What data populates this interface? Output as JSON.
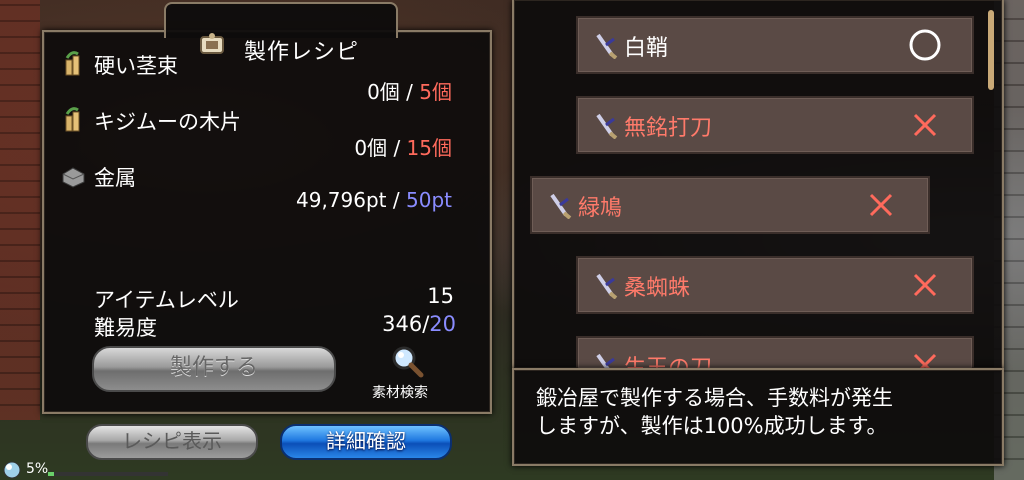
{
  "title": "製作レシピ",
  "materials": [
    {
      "name": "硬い茎束",
      "have": "0個",
      "sep": "/",
      "need": "5個",
      "need_color": "red",
      "icon": "bamboo-icon"
    },
    {
      "name": "キジムーの木片",
      "have": "0個",
      "sep": "/",
      "need": "15個",
      "need_color": "red",
      "icon": "bamboo-icon"
    },
    {
      "name": "金属",
      "have": "49,796pt",
      "sep": "/",
      "need": "50pt",
      "need_color": "blue",
      "icon": "metal-ingot-icon"
    }
  ],
  "stats": {
    "item_level_label": "アイテムレベル",
    "item_level_value": "15",
    "difficulty_label": "難易度",
    "difficulty_value": "346",
    "difficulty_sep": "/",
    "difficulty_req": "20"
  },
  "buttons": {
    "craft": "製作する",
    "material_search": "素材検索",
    "recipe_display": "レシピ表示",
    "detail_confirm": "詳細確認"
  },
  "recipes": [
    {
      "name": "白鞘",
      "status": "circle",
      "color": "#ffffff"
    },
    {
      "name": "無銘打刀",
      "status": "cross",
      "color": "#ff7a6a"
    },
    {
      "name": "緑鳩",
      "status": "cross",
      "color": "#ff7a6a"
    },
    {
      "name": "桑蜘蛛",
      "status": "cross",
      "color": "#ff7a6a"
    },
    {
      "name": "生王の刀",
      "status": "cross",
      "color": "#ff7a6a"
    }
  ],
  "info": {
    "line1": "鍛冶屋で製作する場合、手数料が発生",
    "line2": "しますが、製作は100%成功します。"
  },
  "status": {
    "percent": "5%",
    "fill": 0.05
  }
}
